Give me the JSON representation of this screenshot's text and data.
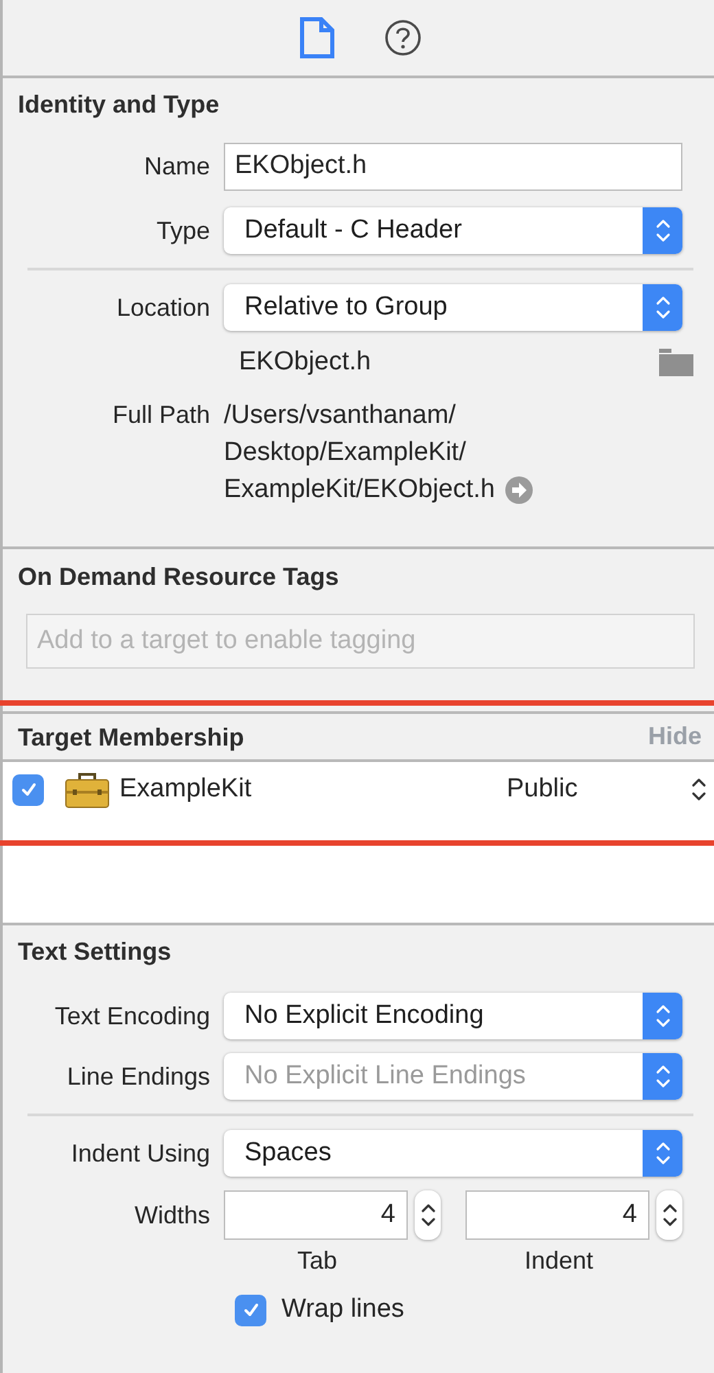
{
  "toolbar": {
    "tabs": [
      {
        "kind": "file",
        "selected": true
      },
      {
        "kind": "help",
        "selected": false
      }
    ]
  },
  "identity": {
    "title": "Identity and Type",
    "rows": [
      {
        "kind": "text",
        "label": "Name",
        "value": "EKObject.h"
      },
      {
        "kind": "popup",
        "label": "Type",
        "value": "Default - C Header",
        "disabled": false
      },
      {
        "kind": "divider"
      },
      {
        "kind": "popup",
        "label": "Location",
        "value": "Relative to Group",
        "disabled": false
      },
      {
        "kind": "file",
        "value": "EKObject.h"
      },
      {
        "kind": "path",
        "label": "Full Path",
        "lines": [
          "/Users/vsanthanam/",
          "Desktop/ExampleKit/",
          "ExampleKit/EKObject.h"
        ]
      }
    ]
  },
  "resource_tags": {
    "title": "On Demand Resource Tags",
    "placeholder": "Add to a target to enable tagging"
  },
  "target_membership": {
    "title": "Target Membership",
    "hide_label": "Hide",
    "targets": [
      {
        "name": "ExampleKit",
        "checked": true,
        "access": "Public"
      }
    ]
  },
  "text_settings": {
    "title": "Text Settings",
    "rows": [
      {
        "kind": "popup",
        "label": "Text Encoding",
        "value": "No Explicit Encoding",
        "disabled": false
      },
      {
        "kind": "popup",
        "label": "Line Endings",
        "value": "No Explicit Line Endings",
        "disabled": true
      },
      {
        "kind": "divider"
      },
      {
        "kind": "popup",
        "label": "Indent Using",
        "value": "Spaces",
        "disabled": false
      },
      {
        "kind": "steppers",
        "label": "Widths",
        "fields": [
          {
            "value": "4",
            "caption": "Tab"
          },
          {
            "value": "4",
            "caption": "Indent"
          }
        ]
      },
      {
        "kind": "checkbox",
        "label": "Wrap lines",
        "checked": true
      }
    ]
  }
}
